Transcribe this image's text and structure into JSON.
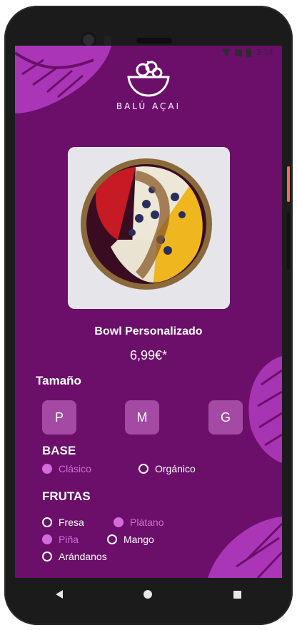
{
  "status_bar": {
    "time": "3:14"
  },
  "brand": {
    "name": "BALÚ AÇAI"
  },
  "product": {
    "title": "Bowl Personalizado",
    "price": "6,99€*"
  },
  "size": {
    "title": "Tamaño",
    "options": [
      "P",
      "M",
      "G"
    ]
  },
  "base": {
    "title": "BASE",
    "options": [
      {
        "label": "Clásico",
        "selected": true
      },
      {
        "label": "Orgánico",
        "selected": false
      }
    ]
  },
  "frutas": {
    "title": "FRUTAS",
    "options": [
      {
        "label": "Fresa",
        "selected": false
      },
      {
        "label": "Plátano",
        "selected": true
      },
      {
        "label": "Piña",
        "selected": true
      },
      {
        "label": "Mango",
        "selected": false
      },
      {
        "label": "Arándanos",
        "selected": false
      }
    ]
  },
  "colors": {
    "background": "#6b0f6a",
    "accent": "#d36bd8",
    "size_button": "#a54aa4"
  },
  "icons": [
    "wifi-icon",
    "signal-icon",
    "battery-icon",
    "bowl-logo-icon",
    "monstera-leaf-icon",
    "back-icon",
    "home-icon",
    "recents-icon"
  ]
}
